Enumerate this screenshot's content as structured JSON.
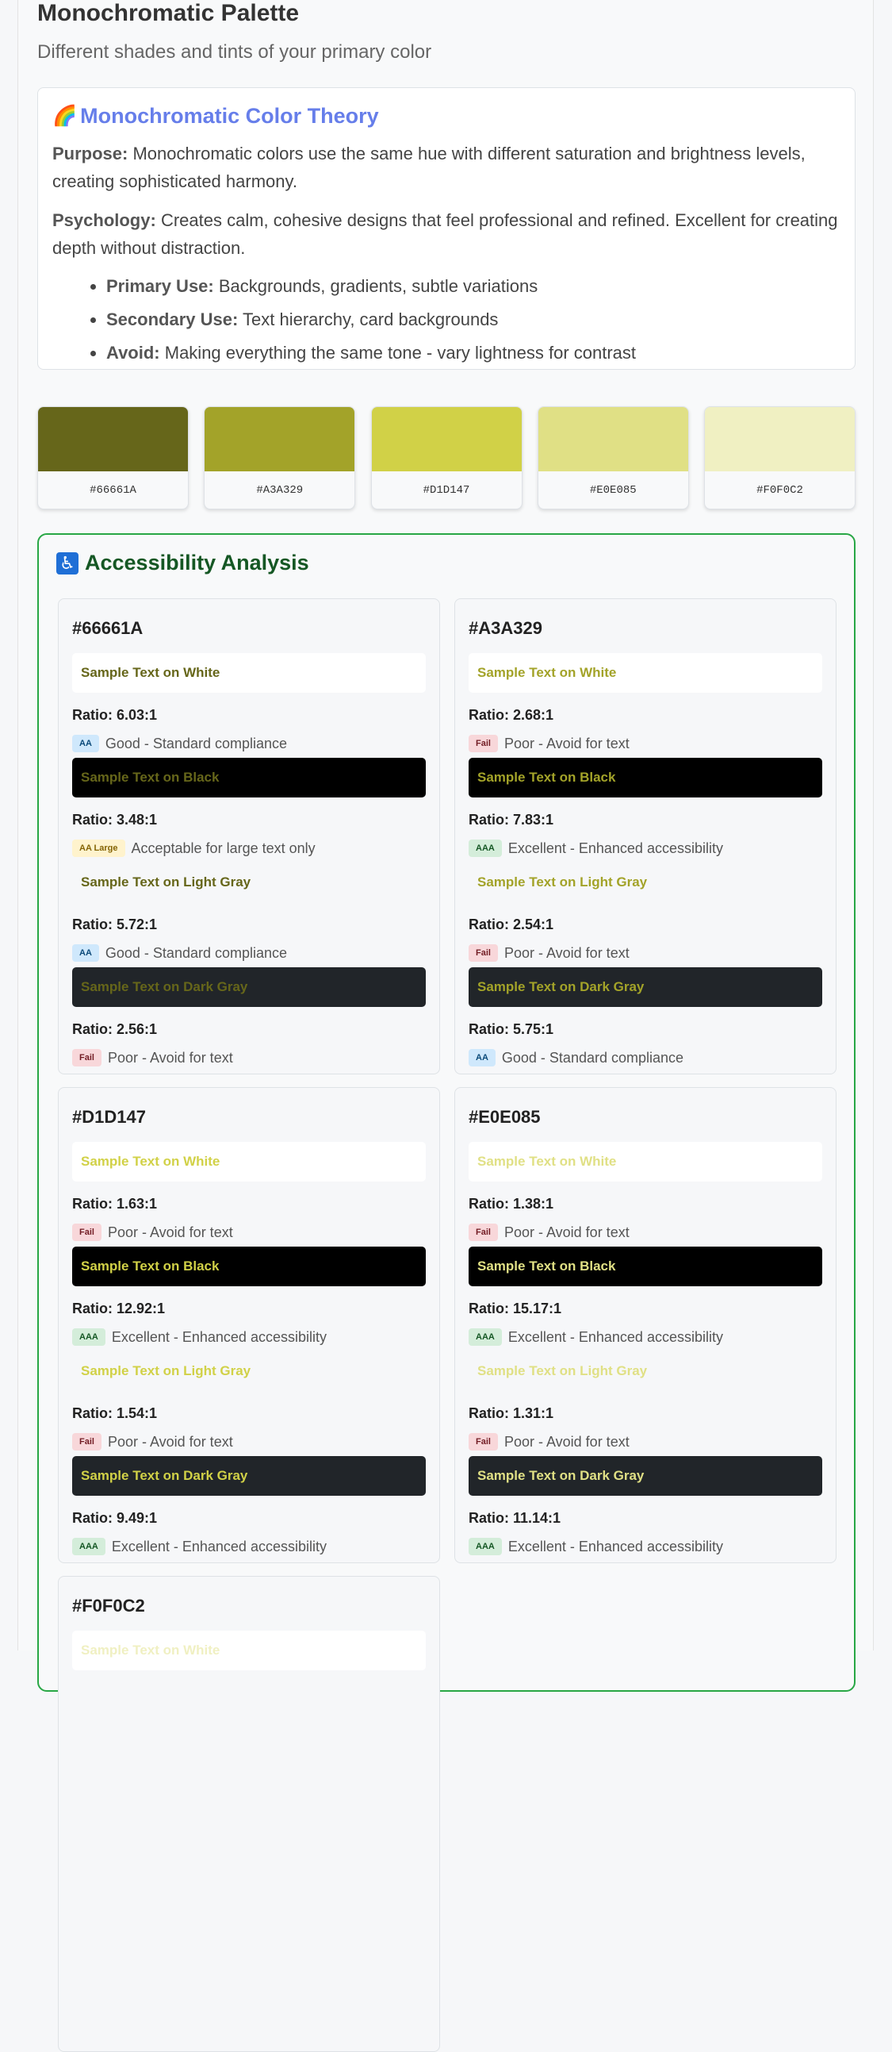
{
  "header": {
    "title": "Monochromatic Palette",
    "subtitle": "Different shades and tints of your primary color"
  },
  "theory": {
    "heading": "Monochromatic Color Theory",
    "icon": "rainbow-icon",
    "purpose_label": "Purpose:",
    "purpose_text": "Monochromatic colors use the same hue with different saturation and brightness levels, creating sophisticated harmony.",
    "psychology_label": "Psychology:",
    "psychology_text": "Creates calm, cohesive designs that feel professional and refined. Excellent for creating depth without distraction.",
    "bullets": [
      {
        "label": "Primary Use:",
        "text": "Backgrounds, gradients, subtle variations"
      },
      {
        "label": "Secondary Use:",
        "text": "Text hierarchy, card backgrounds"
      },
      {
        "label": "Avoid:",
        "text": "Making everything the same tone - vary lightness for contrast"
      }
    ]
  },
  "swatches": [
    {
      "hex": "#66661A",
      "color": "#66661A"
    },
    {
      "hex": "#A3A329",
      "color": "#A3A329"
    },
    {
      "hex": "#D1D147",
      "color": "#D1D147"
    },
    {
      "hex": "#E0E085",
      "color": "#E0E085"
    },
    {
      "hex": "#F0F0C2",
      "color": "#F0F0C2"
    }
  ],
  "accessibility": {
    "heading": "Accessibility Analysis",
    "icon": "wheelchair-icon",
    "cards": [
      {
        "hex": "#66661A",
        "color": "#66661A",
        "tests": [
          {
            "label": "Sample Text on White",
            "bg": "white",
            "ratio": "Ratio: 6.03:1",
            "badge": "AA",
            "badge_class": "AA",
            "desc": "Good - Standard compliance"
          },
          {
            "label": "Sample Text on Black",
            "bg": "black",
            "ratio": "Ratio: 3.48:1",
            "badge": "AA Large",
            "badge_class": "AALarge",
            "desc": "Acceptable for large text only"
          },
          {
            "label": "Sample Text on Light Gray",
            "bg": "light",
            "ratio": "Ratio: 5.72:1",
            "badge": "AA",
            "badge_class": "AA",
            "desc": "Good - Standard compliance"
          },
          {
            "label": "Sample Text on Dark Gray",
            "bg": "dark",
            "ratio": "Ratio: 2.56:1",
            "badge": "Fail",
            "badge_class": "Fail",
            "desc": "Poor - Avoid for text"
          }
        ]
      },
      {
        "hex": "#A3A329",
        "color": "#A3A329",
        "tests": [
          {
            "label": "Sample Text on White",
            "bg": "white",
            "ratio": "Ratio: 2.68:1",
            "badge": "Fail",
            "badge_class": "Fail",
            "desc": "Poor - Avoid for text"
          },
          {
            "label": "Sample Text on Black",
            "bg": "black",
            "ratio": "Ratio: 7.83:1",
            "badge": "AAA",
            "badge_class": "AAA",
            "desc": "Excellent - Enhanced accessibility"
          },
          {
            "label": "Sample Text on Light Gray",
            "bg": "light",
            "ratio": "Ratio: 2.54:1",
            "badge": "Fail",
            "badge_class": "Fail",
            "desc": "Poor - Avoid for text"
          },
          {
            "label": "Sample Text on Dark Gray",
            "bg": "dark",
            "ratio": "Ratio: 5.75:1",
            "badge": "AA",
            "badge_class": "AA",
            "desc": "Good - Standard compliance"
          }
        ]
      },
      {
        "hex": "#D1D147",
        "color": "#D1D147",
        "tests": [
          {
            "label": "Sample Text on White",
            "bg": "white",
            "ratio": "Ratio: 1.63:1",
            "badge": "Fail",
            "badge_class": "Fail",
            "desc": "Poor - Avoid for text"
          },
          {
            "label": "Sample Text on Black",
            "bg": "black",
            "ratio": "Ratio: 12.92:1",
            "badge": "AAA",
            "badge_class": "AAA",
            "desc": "Excellent - Enhanced accessibility"
          },
          {
            "label": "Sample Text on Light Gray",
            "bg": "light",
            "ratio": "Ratio: 1.54:1",
            "badge": "Fail",
            "badge_class": "Fail",
            "desc": "Poor - Avoid for text"
          },
          {
            "label": "Sample Text on Dark Gray",
            "bg": "dark",
            "ratio": "Ratio: 9.49:1",
            "badge": "AAA",
            "badge_class": "AAA",
            "desc": "Excellent - Enhanced accessibility"
          }
        ]
      },
      {
        "hex": "#E0E085",
        "color": "#E0E085",
        "tests": [
          {
            "label": "Sample Text on White",
            "bg": "white",
            "ratio": "Ratio: 1.38:1",
            "badge": "Fail",
            "badge_class": "Fail",
            "desc": "Poor - Avoid for text"
          },
          {
            "label": "Sample Text on Black",
            "bg": "black",
            "ratio": "Ratio: 15.17:1",
            "badge": "AAA",
            "badge_class": "AAA",
            "desc": "Excellent - Enhanced accessibility"
          },
          {
            "label": "Sample Text on Light Gray",
            "bg": "light",
            "ratio": "Ratio: 1.31:1",
            "badge": "Fail",
            "badge_class": "Fail",
            "desc": "Poor - Avoid for text"
          },
          {
            "label": "Sample Text on Dark Gray",
            "bg": "dark",
            "ratio": "Ratio: 11.14:1",
            "badge": "AAA",
            "badge_class": "AAA",
            "desc": "Excellent - Enhanced accessibility"
          }
        ]
      },
      {
        "hex": "#F0F0C2",
        "color": "#F0F0C2",
        "tests": [
          {
            "label": "Sample Text on White",
            "bg": "white"
          }
        ]
      }
    ]
  }
}
